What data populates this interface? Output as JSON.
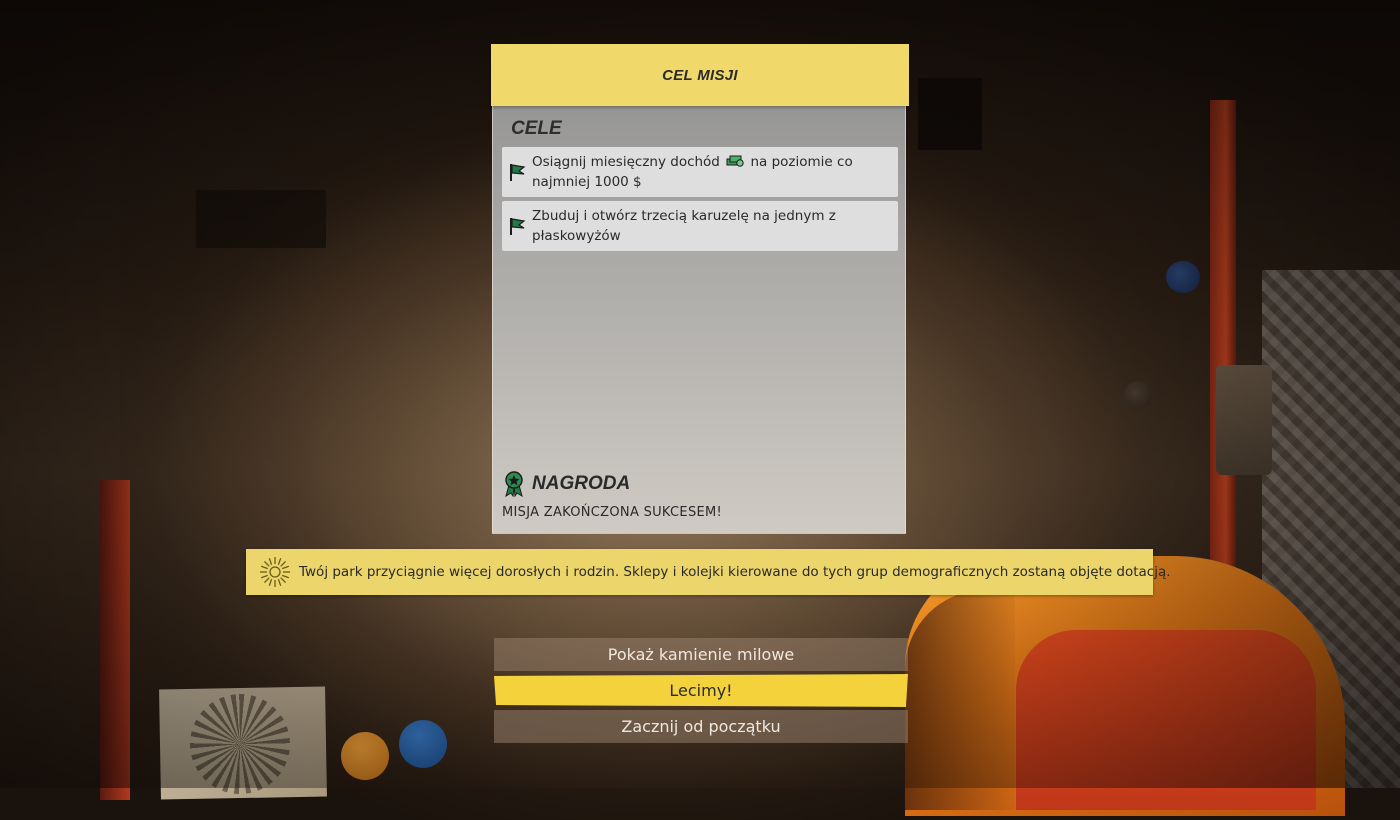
{
  "mission": {
    "header_title": "CEL MISJI",
    "objectives_title": "CELE",
    "objectives": [
      {
        "text_before_icon": "Osiągnij miesięczny dochód",
        "icon": "money-icon",
        "text_after_icon": "na poziomie co najmniej 1000 $"
      },
      {
        "text": "Zbuduj i otwórz trzecią karuzelę na jednym z płaskowyżów"
      }
    ],
    "reward_title": "NAGRODA",
    "reward_text": "MISJA ZAKOŃCZONA SUKCESEM!"
  },
  "info_banner": {
    "icon": "sunburst-icon",
    "text": "Twój park przyciągnie więcej dorosłych i rodzin. Sklepy i kolejki kierowane do tych grup demograficznych zostaną objęte dotacją."
  },
  "menu": {
    "show_milestones": "Pokaż kamienie milowe",
    "go": "Lecimy!",
    "restart": "Zacznij od początku"
  },
  "colors": {
    "header_yellow": "#f0d86a",
    "banner_yellow": "#ecd66b",
    "primary_button": "#f4d23c",
    "flag_green": "#1f7a45"
  }
}
